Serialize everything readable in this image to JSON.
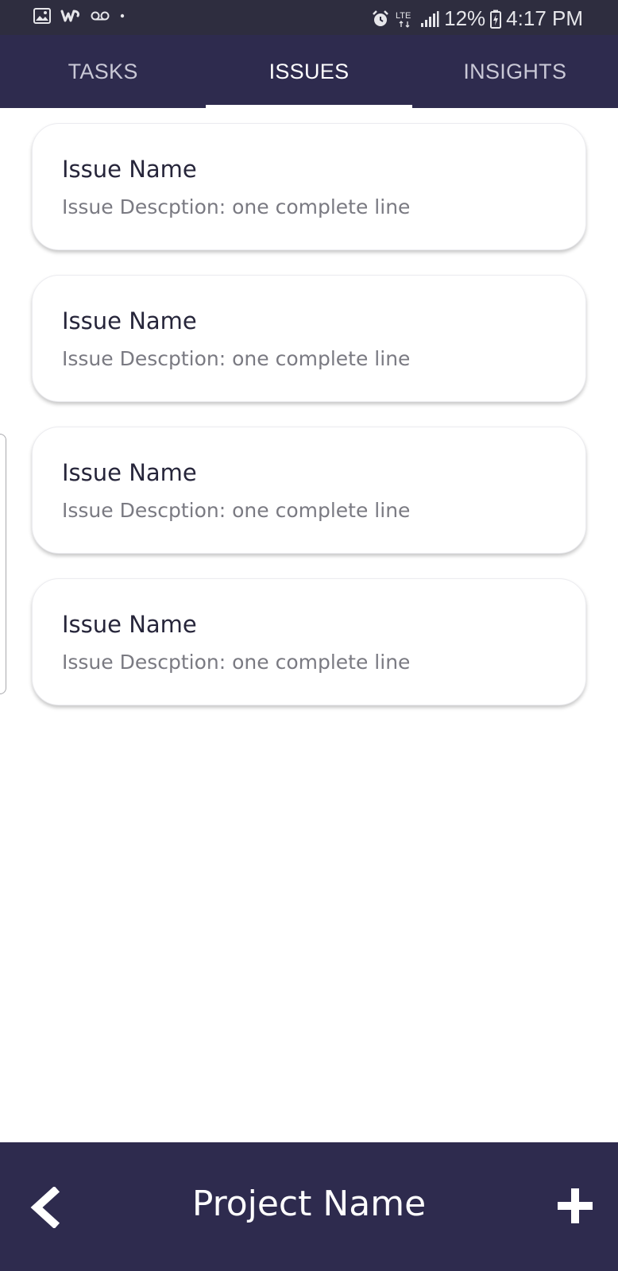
{
  "status_bar": {
    "left_icons": [
      "image-icon",
      "wish-app-icon",
      "voicemail-icon",
      "dot-icon"
    ],
    "right_icons": [
      "alarm-icon",
      "lte-icon",
      "signal-icon"
    ],
    "battery": "12%",
    "time": "4:17 PM"
  },
  "tabs": [
    {
      "label": "TASKS",
      "active": false
    },
    {
      "label": "ISSUES",
      "active": true
    },
    {
      "label": "INSIGHTS",
      "active": false
    }
  ],
  "issues": [
    {
      "name": "Issue Name",
      "description": "Issue Descption: one complete line"
    },
    {
      "name": "Issue Name",
      "description": "Issue Descption: one complete line"
    },
    {
      "name": "Issue Name",
      "description": "Issue Descption: one complete line"
    },
    {
      "name": "Issue Name",
      "description": "Issue Descption: one complete line"
    }
  ],
  "bottom_bar": {
    "title": "Project Name",
    "back_icon": "chevron-left-icon",
    "add_icon": "plus-icon"
  },
  "colors": {
    "status_bar_bg": "#2e2d3f",
    "primary": "#2e2b4e",
    "active_tab_text": "#ffffff",
    "inactive_tab_text": "#c9c8d6"
  }
}
